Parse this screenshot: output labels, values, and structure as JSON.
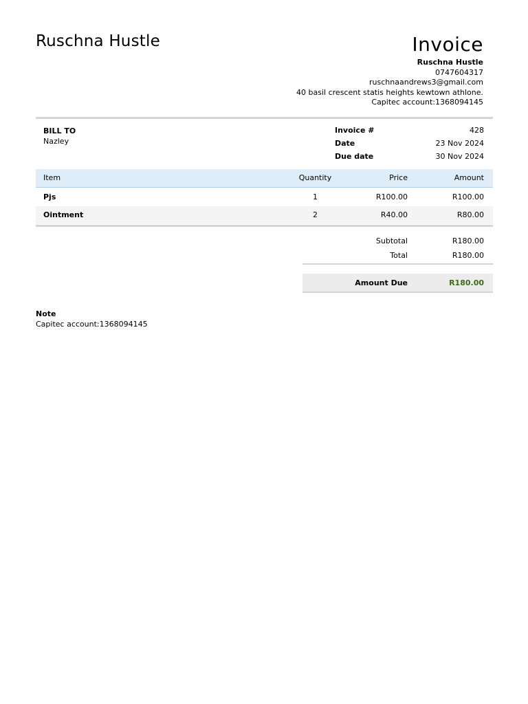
{
  "header": {
    "business_name": "Ruschna Hustle",
    "title": "Invoice"
  },
  "from": {
    "name": "Ruschna Hustle",
    "phone": "0747604317",
    "email": "ruschnaandrews3@gmail.com",
    "address": "40 basil crescent statis heights kewtown athlone.",
    "account": "Capitec account:1368094145"
  },
  "bill_to": {
    "label": "BILL TO",
    "name": "Nazley"
  },
  "meta": {
    "invoice_label": "Invoice #",
    "invoice_value": "428",
    "date_label": "Date",
    "date_value": "23 Nov 2024",
    "due_label": "Due date",
    "due_value": "30 Nov 2024"
  },
  "items": {
    "headers": [
      "Item",
      "Quantity",
      "Price",
      "Amount"
    ],
    "rows": [
      [
        "Pjs",
        "1",
        "R100.00",
        "R100.00"
      ],
      [
        "Ointment",
        "2",
        "R40.00",
        "R80.00"
      ]
    ]
  },
  "totals": {
    "subtotal_label": "Subtotal",
    "subtotal_value": "R180.00",
    "total_label": "Total",
    "total_value": "R180.00",
    "amount_due_label": "Amount Due",
    "amount_due_value": "R180.00"
  },
  "note": {
    "label": "Note",
    "text": "Capitec account:1368094145"
  },
  "colors": {
    "header_bg": "#deedf8",
    "amount_due_color": "#3d6b1a"
  }
}
